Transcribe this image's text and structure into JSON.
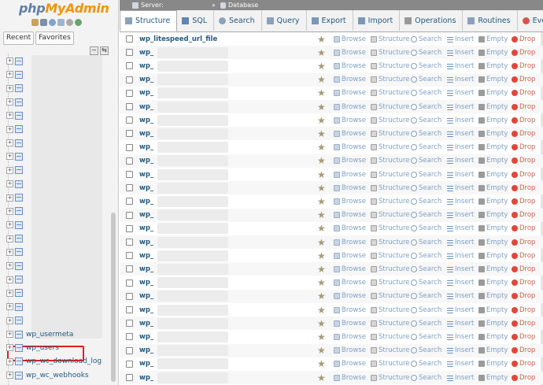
{
  "app": {
    "logo_php": "php",
    "logo_admin": "MyAdmin"
  },
  "nav": {
    "tabs": [
      "Recent",
      "Favorites"
    ],
    "collapse_symbol": "−",
    "link_symbol": "⇆",
    "visible_tables": [
      "wp_usermeta",
      "wp_users",
      "wp_wc_download_log",
      "wp_wc_webhooks"
    ],
    "highlighted_table": "wp_users"
  },
  "breadcrumb": {
    "server_label": "Server:",
    "database_label": "Database"
  },
  "tabs": [
    {
      "label": "Structure",
      "icon": "structure-icon",
      "active": true
    },
    {
      "label": "SQL",
      "icon": "sql-icon",
      "active": false
    },
    {
      "label": "Search",
      "icon": "search-icon",
      "active": false
    },
    {
      "label": "Query",
      "icon": "query-icon",
      "active": false
    },
    {
      "label": "Export",
      "icon": "export-icon",
      "active": false
    },
    {
      "label": "Import",
      "icon": "import-icon",
      "active": false
    },
    {
      "label": "Operations",
      "icon": "wrench-icon",
      "active": false
    },
    {
      "label": "Routines",
      "icon": "routines-icon",
      "active": false
    },
    {
      "label": "Events",
      "icon": "events-icon",
      "active": false
    }
  ],
  "table_list": {
    "first_row_name": "wp_litespeed_url_file",
    "row_prefix": "wp_",
    "row_count": 26,
    "actions": [
      "Browse",
      "Structure",
      "Search",
      "Insert",
      "Empty",
      "Drop"
    ]
  },
  "colors": {
    "link": "#235a81",
    "action_link": "#7ea0c4",
    "drop": "#c6664f",
    "highlight_border": "#e02020"
  }
}
